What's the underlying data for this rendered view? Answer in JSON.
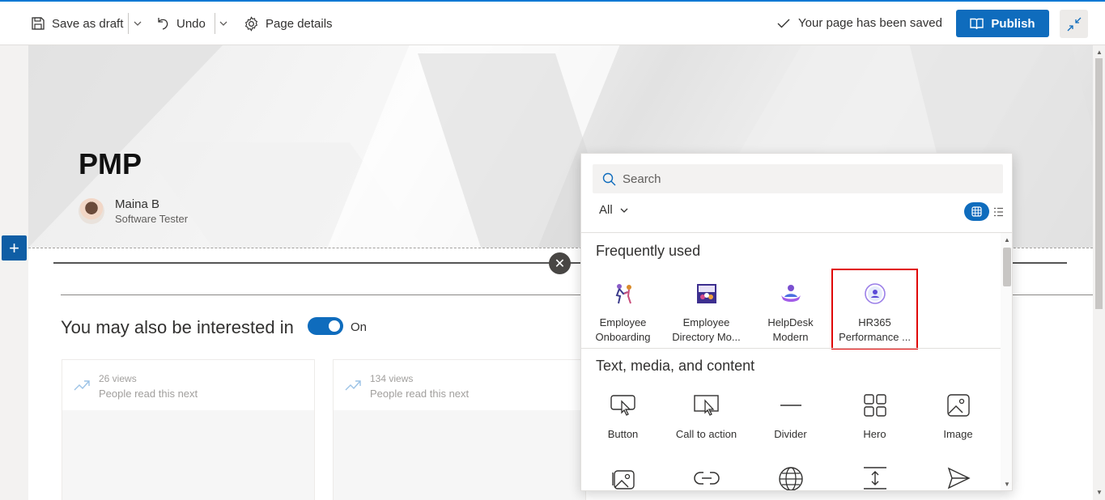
{
  "toolbar": {
    "save_draft": "Save as draft",
    "undo": "Undo",
    "page_details": "Page details",
    "saved_status": "Your page has been saved",
    "publish": "Publish"
  },
  "page": {
    "title": "PMP",
    "author_name": "Maina B",
    "author_role": "Software Tester"
  },
  "related": {
    "title": "You may also be interested in",
    "toggle_label": "On",
    "cards": [
      {
        "views": "26 views",
        "caption": "People read this next"
      },
      {
        "views": "134 views",
        "caption": "People read this next"
      }
    ]
  },
  "toolbox": {
    "search_placeholder": "Search",
    "filter": "All",
    "frequently_used_heading": "Frequently used",
    "frequently_used": [
      {
        "label_line1": "Employee",
        "label_line2": "Onboarding",
        "icon": "employee-onboarding-icon"
      },
      {
        "label_line1": "Employee",
        "label_line2": "Directory Mo...",
        "icon": "employee-directory-icon"
      },
      {
        "label_line1": "HelpDesk",
        "label_line2": "Modern",
        "icon": "helpdesk-icon"
      },
      {
        "label_line1": "HR365",
        "label_line2": "Performance ...",
        "icon": "hr365-performance-icon"
      }
    ],
    "text_media_heading": "Text, media, and content",
    "text_media": [
      {
        "label": "Button",
        "icon": "button-icon"
      },
      {
        "label": "Call to action",
        "icon": "call-to-action-icon"
      },
      {
        "label": "Divider",
        "icon": "divider-icon"
      },
      {
        "label": "Hero",
        "icon": "hero-icon"
      },
      {
        "label": "Image",
        "icon": "image-icon"
      }
    ]
  },
  "colors": {
    "accent": "#0f6cbd",
    "selection_outline": "#e00000"
  }
}
